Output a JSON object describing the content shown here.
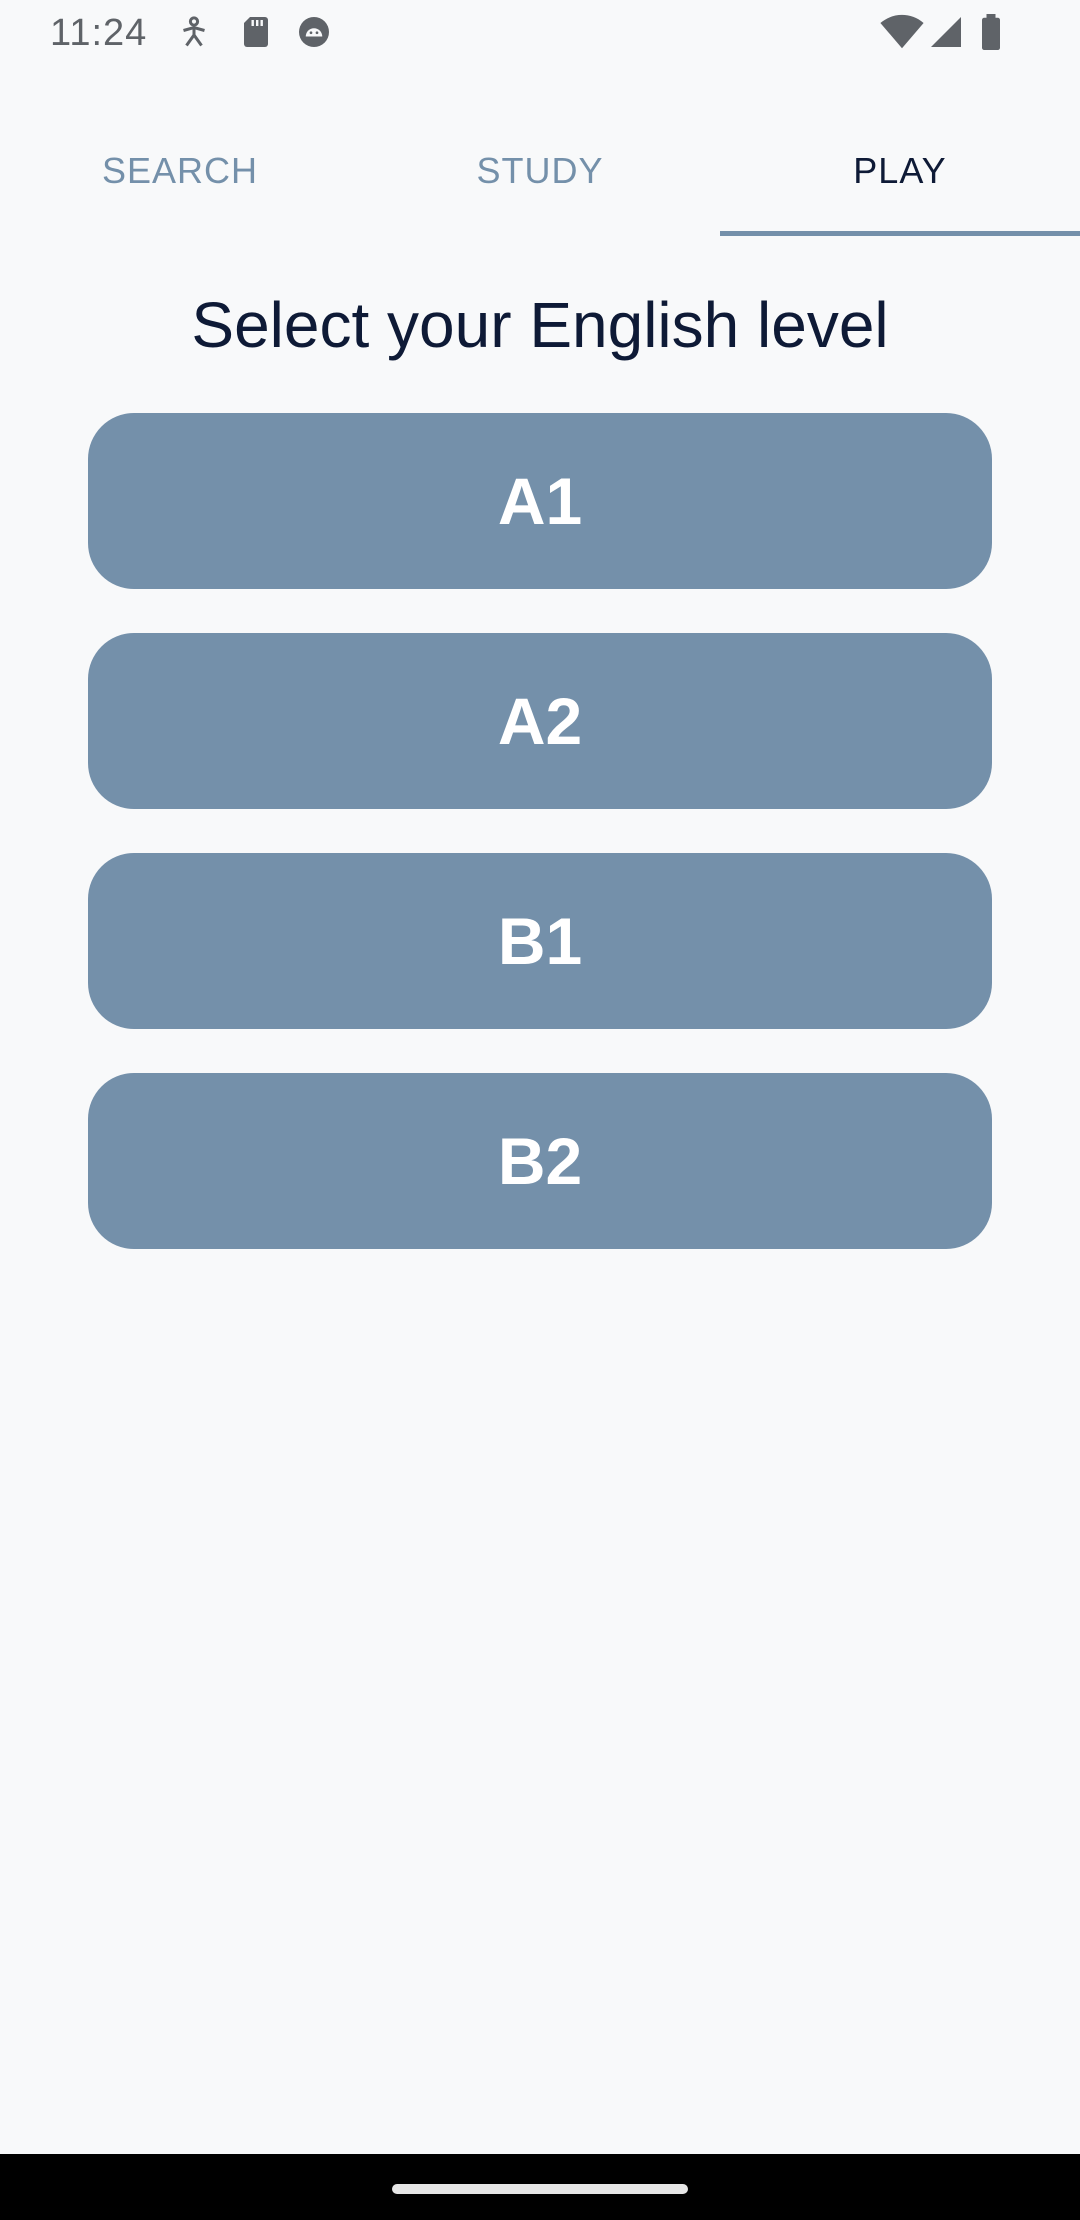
{
  "status_bar": {
    "time": "11:24",
    "icons_left": [
      "accessibility-icon",
      "sd-card-icon",
      "android-debug-icon"
    ],
    "icons_right": [
      "wifi-icon",
      "cell-signal-icon",
      "battery-icon"
    ]
  },
  "tabs": [
    {
      "label": "SEARCH",
      "active": false
    },
    {
      "label": "STUDY",
      "active": false
    },
    {
      "label": "PLAY",
      "active": true
    }
  ],
  "heading": "Select your English level",
  "levels": [
    {
      "label": "A1"
    },
    {
      "label": "A2"
    },
    {
      "label": "B1"
    },
    {
      "label": "B2"
    }
  ],
  "colors": {
    "accent": "#7490aa",
    "text_dark": "#0e1a36",
    "background": "#f8f9fa"
  }
}
